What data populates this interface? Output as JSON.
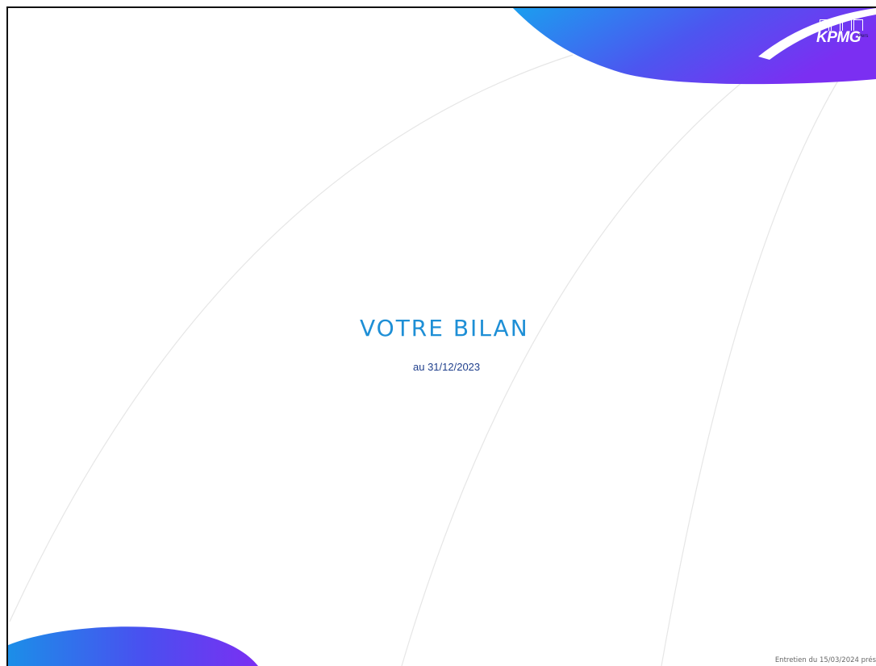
{
  "slide": {
    "title": "VOTRE BILAN",
    "subtitle": "au 31/12/2023",
    "footer": "Entretien du 15/03/2024 prés"
  },
  "logo": {
    "text": "KPMG",
    "tag": "Pers"
  },
  "colors": {
    "title": "#1e8fd6",
    "subtitle": "#1f3f8c",
    "accent_blue": "#1b8fe8",
    "accent_violet": "#7b2ff2",
    "arc_lines": "#e6e6e6"
  }
}
